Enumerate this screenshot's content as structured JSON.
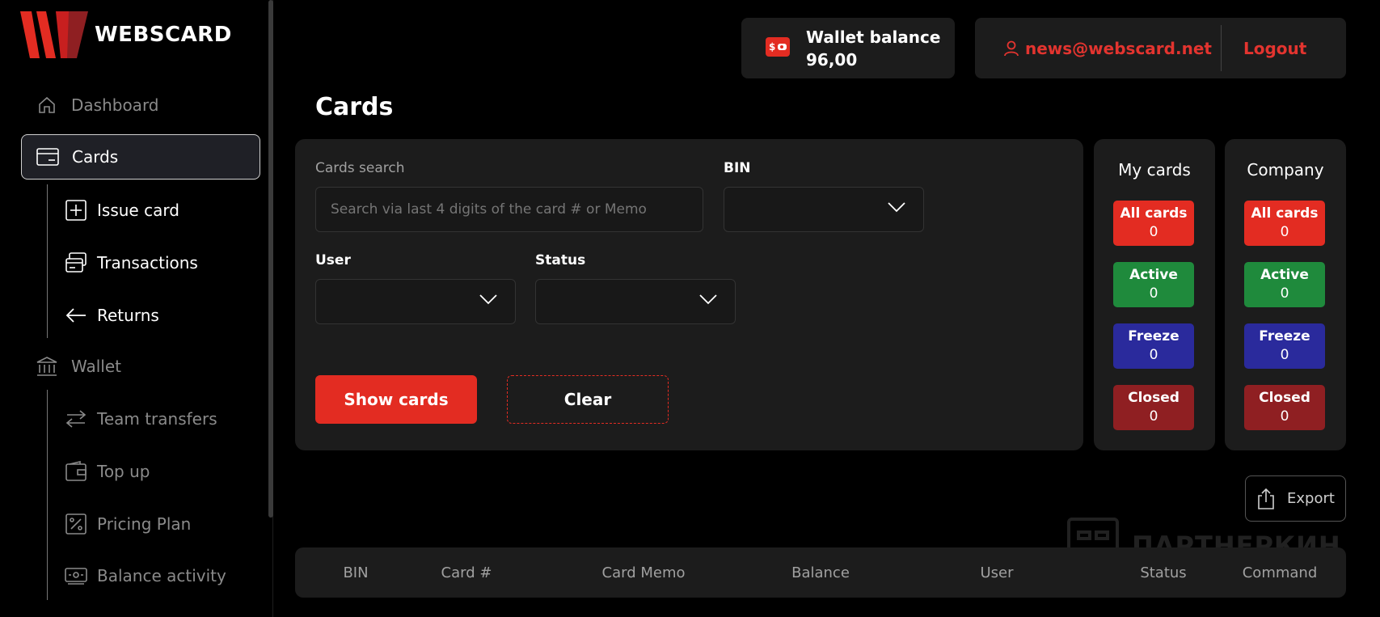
{
  "brand": {
    "name": "WEBSCARD"
  },
  "sidebar": {
    "items": [
      {
        "label": "Dashboard",
        "icon": "home-icon"
      },
      {
        "label": "Cards",
        "icon": "card-icon",
        "active": true
      },
      {
        "label": "Issue card",
        "icon": "plus-square-icon"
      },
      {
        "label": "Transactions",
        "icon": "transactions-icon"
      },
      {
        "label": "Returns",
        "icon": "arrow-left-icon"
      },
      {
        "label": "Wallet",
        "icon": "bank-icon"
      },
      {
        "label": "Team transfers",
        "icon": "transfer-icon"
      },
      {
        "label": "Top up",
        "icon": "wallet-icon"
      },
      {
        "label": "Pricing Plan",
        "icon": "percent-icon"
      },
      {
        "label": "Balance activity",
        "icon": "activity-icon"
      }
    ]
  },
  "header": {
    "wallet_title": "Wallet balance",
    "wallet_value": "96,00",
    "email": "news@webscard.net",
    "logout": "Logout"
  },
  "page": {
    "title": "Cards"
  },
  "filters": {
    "search_label": "Cards search",
    "search_placeholder": "Search via last 4 digits of the card # or Memo",
    "bin_label": "BIN",
    "user_label": "User",
    "status_label": "Status",
    "show_button": "Show cards",
    "clear_button": "Clear"
  },
  "stats": {
    "my_cards": {
      "title": "My cards",
      "items": [
        {
          "label": "All cards",
          "count": "0"
        },
        {
          "label": "Active",
          "count": "0"
        },
        {
          "label": "Freeze",
          "count": "0"
        },
        {
          "label": "Closed",
          "count": "0"
        }
      ]
    },
    "company": {
      "title": "Company",
      "items": [
        {
          "label": "All cards",
          "count": "0"
        },
        {
          "label": "Active",
          "count": "0"
        },
        {
          "label": "Freeze",
          "count": "0"
        },
        {
          "label": "Closed",
          "count": "0"
        }
      ]
    }
  },
  "export_label": "Export",
  "watermark": "ПАРТНЕРКИН",
  "table": {
    "columns": [
      "BIN",
      "Card #",
      "Card Memo",
      "Balance",
      "User",
      "Status",
      "Command"
    ]
  },
  "colors": {
    "accent": "#e32c22",
    "active": "#1f8a3c",
    "freeze": "#2a2a9c",
    "closed": "#8f1f22",
    "panel": "#1c1c1c"
  }
}
